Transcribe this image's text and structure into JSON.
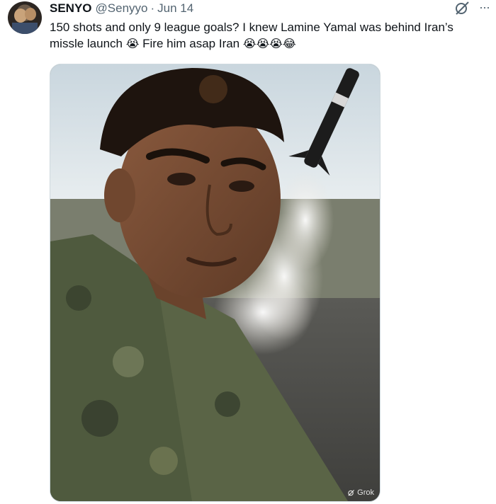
{
  "tweet": {
    "display_name": "SENYO",
    "handle": "@Senyyo",
    "separator": "·",
    "date": "Jun 14",
    "text_part1": "150 shots and only 9 league goals? I knew Lamine Yamal was behind Iran’s missle launch ",
    "emoji1": "😭",
    "text_part2": " Fire him asap Iran ",
    "emojis2": "😭😭😭😂",
    "more_label": "···"
  },
  "media": {
    "watermark_label": "Grok",
    "icons": [
      "grok-icon",
      "more-icon"
    ]
  }
}
